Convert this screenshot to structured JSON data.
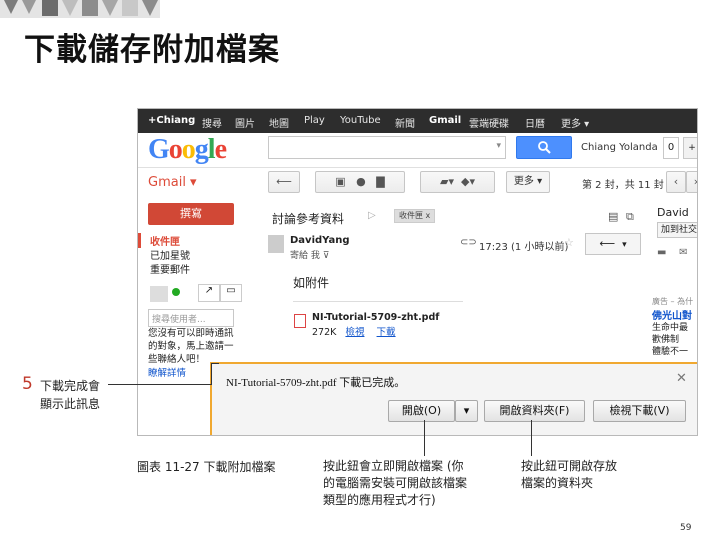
{
  "slide": {
    "title": "下載儲存附加檔案",
    "callout_number": "5",
    "callout_line1": "下載完成會",
    "callout_line2": "顯示此訊息",
    "caption": "圖表 11-27  下載附加檔案",
    "note1": [
      "按此鈕會立即開啟檔案 (你",
      "的電腦需安裝可開啟該檔案",
      "類型的應用程式才行)"
    ],
    "note2": [
      "按此鈕可開啟存放",
      "檔案的資料夾"
    ],
    "page_number": "59"
  },
  "google_bar": {
    "items": [
      "+Chiang",
      "搜尋",
      "圖片",
      "地圖",
      "Play",
      "YouTube",
      "新聞",
      "Gmail",
      "雲端硬碟",
      "日曆",
      "更多 ▾"
    ]
  },
  "header": {
    "logo": [
      "G",
      "o",
      "o",
      "g",
      "l",
      "e"
    ],
    "logo_colors": [
      "#4285f4",
      "#ea4335",
      "#fbbc05",
      "#4285f4",
      "#34a853",
      "#ea4335"
    ],
    "user_name": "Chiang Yolanda",
    "notification_count": "0"
  },
  "toolbar": {
    "gmail_label": "Gmail ▾",
    "more_label": "更多 ▾",
    "pagination": "第 2 封，共 11 封"
  },
  "sidebar": {
    "compose_label": "撰寫",
    "items": [
      {
        "label": "收件匣"
      },
      {
        "label": "已加星號"
      },
      {
        "label": "重要郵件"
      }
    ],
    "chat_search_placeholder": "搜尋使用者...",
    "chat_text": [
      "您沒有可以即時通訊",
      "的對象，馬上邀請一",
      "些聯絡人吧！"
    ],
    "chat_link": "瞭解詳情"
  },
  "email": {
    "subject": "討論參考資料",
    "label_tag": "收件匣  x",
    "sender": "DavidYang",
    "to": "寄給 我 ⊽",
    "time": "17:23 (1 小時以前)",
    "body": "如附件",
    "attachment_name": "NI-Tutorial-5709-zht.pdf",
    "attachment_size": "272K",
    "attachment_view": "檢視",
    "attachment_download": "下載"
  },
  "right_panel": {
    "name": "David",
    "add_button": "加到社交圈",
    "ads_label": "廣告 – 為什",
    "ad_title": "佛光山對",
    "ad_text": [
      "生命中最",
      "歡佛制",
      "體驗不一"
    ]
  },
  "download_bar": {
    "message": "NI-Tutorial-5709-zht.pdf 下載已完成。",
    "open_label": "開啟(O)",
    "open_folder_label": "開啟資料夾(F)",
    "view_downloads_label": "檢視下載(V)"
  }
}
